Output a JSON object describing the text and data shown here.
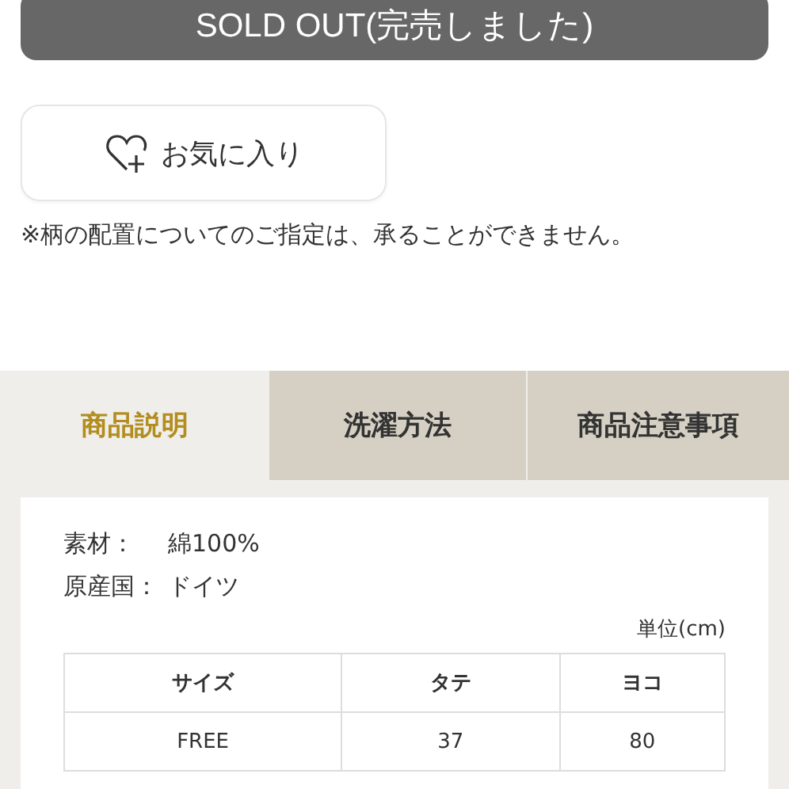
{
  "sold_out_button": {
    "label": "SOLD OUT(完売しました)",
    "disabled": true
  },
  "favorite_button": {
    "label": "お気に入り"
  },
  "note": "※柄の配置についてのご指定は、承ることができません。",
  "tabs": [
    {
      "label": "商品説明",
      "selected": true
    },
    {
      "label": "洗濯方法",
      "selected": false
    },
    {
      "label": "商品注意事項",
      "selected": false
    }
  ],
  "details": [
    {
      "label": "素材：",
      "value": "綿100%"
    },
    {
      "label": "原産国：",
      "value": "ドイツ"
    }
  ],
  "unit": "単位(cm)",
  "table": {
    "columns": [
      "サイズ",
      "タテ",
      "ヨコ"
    ],
    "rows": [
      [
        "FREE",
        "37",
        "80"
      ]
    ]
  }
}
